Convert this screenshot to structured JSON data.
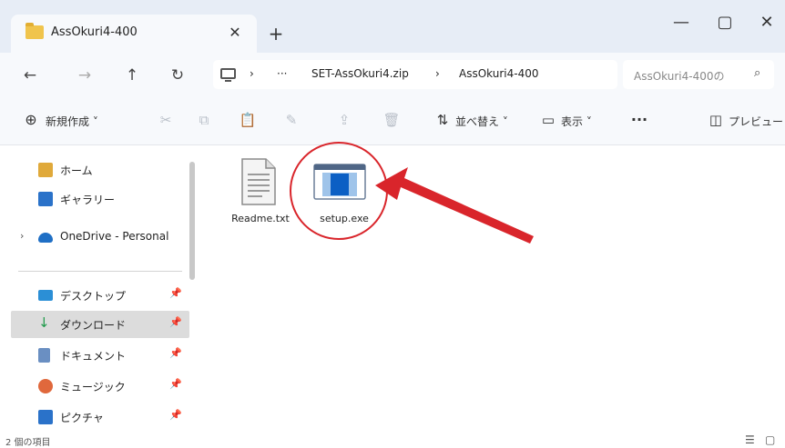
{
  "window": {
    "tab_title": "AssOkuri4-400",
    "tab_close": "✕",
    "new_tab": "+",
    "minimize": "—",
    "maximize": "▢",
    "close": "✕"
  },
  "nav": {
    "back": "←",
    "forward": "→",
    "up": "↑",
    "refresh": "↻",
    "breadcrumb_sep": "›",
    "breadcrumb_ellipsis": "···",
    "breadcrumb": [
      "SET-AssOkuri4.zip",
      "AssOkuri4-400"
    ],
    "search_placeholder": "AssOkuri4-400の",
    "search_icon": "⌕"
  },
  "toolbar": {
    "new_icon": "⊕",
    "new_label": "新規作成 ˅",
    "cut_icon": "✂",
    "copy_icon": "⧉",
    "paste_icon": "📋",
    "rename_icon": "✎",
    "share_icon": "⇪",
    "delete_icon": "🗑",
    "sort_icon": "⇅",
    "sort_label": "並べ替え ˅",
    "view_icon": "▭",
    "view_label": "表示 ˅",
    "more_icon": "···",
    "preview_icon": "◫",
    "preview_label": "プレビュー"
  },
  "sidebar": {
    "expand_icon": "›",
    "pin": "📌",
    "items": [
      {
        "label": "ホーム"
      },
      {
        "label": "ギャラリー"
      },
      {
        "label": "OneDrive - Personal"
      },
      {
        "label": "デスクトップ"
      },
      {
        "label": "ダウンロード"
      },
      {
        "label": "ドキュメント"
      },
      {
        "label": "ミュージック"
      },
      {
        "label": "ピクチャ"
      }
    ]
  },
  "files": [
    {
      "name": "Readme.txt",
      "icon": "text-document-icon"
    },
    {
      "name": "setup.exe",
      "icon": "application-icon"
    }
  ],
  "status": {
    "count": "2 個の項目",
    "details_icon": "☰",
    "tiles_icon": "▢"
  },
  "colors": {
    "accent": "#0078d4",
    "highlight_red": "#d9252b",
    "selected_bg": "#dcdcdc",
    "titlebar_bg": "#e7edf6"
  }
}
